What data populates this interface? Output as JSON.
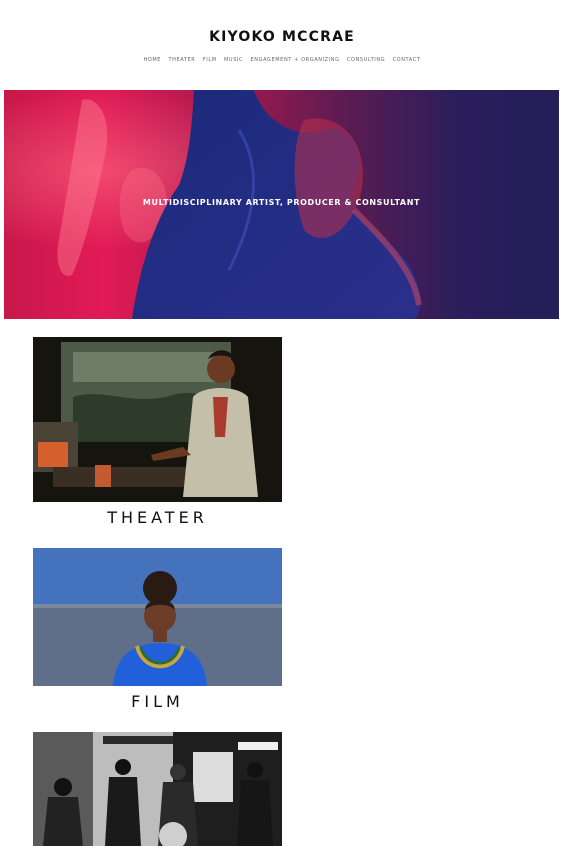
{
  "site": {
    "title": "KIYOKO MCCRAE"
  },
  "nav": {
    "items": [
      {
        "label": "HOME"
      },
      {
        "label": "THEATER"
      },
      {
        "label": "FILM"
      },
      {
        "label": "MUSIC"
      },
      {
        "label": "ENGAGEMENT + ORGANIZING"
      },
      {
        "label": "CONSULTING"
      },
      {
        "label": "CONTACT"
      }
    ]
  },
  "hero": {
    "tagline": "MULTIDISCIPLINARY ARTIST, PRODUCER & CONSULTANT"
  },
  "sections": [
    {
      "label": "THEATER"
    },
    {
      "label": "FILM"
    },
    {
      "label": ""
    }
  ]
}
